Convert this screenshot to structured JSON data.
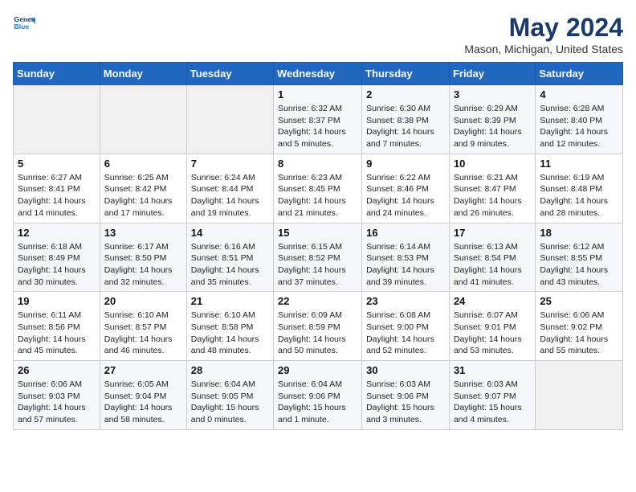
{
  "header": {
    "logo_line1": "General",
    "logo_line2": "Blue",
    "month": "May 2024",
    "location": "Mason, Michigan, United States"
  },
  "weekdays": [
    "Sunday",
    "Monday",
    "Tuesday",
    "Wednesday",
    "Thursday",
    "Friday",
    "Saturday"
  ],
  "weeks": [
    [
      {
        "day": "",
        "info": ""
      },
      {
        "day": "",
        "info": ""
      },
      {
        "day": "",
        "info": ""
      },
      {
        "day": "1",
        "info": "Sunrise: 6:32 AM\nSunset: 8:37 PM\nDaylight: 14 hours\nand 5 minutes."
      },
      {
        "day": "2",
        "info": "Sunrise: 6:30 AM\nSunset: 8:38 PM\nDaylight: 14 hours\nand 7 minutes."
      },
      {
        "day": "3",
        "info": "Sunrise: 6:29 AM\nSunset: 8:39 PM\nDaylight: 14 hours\nand 9 minutes."
      },
      {
        "day": "4",
        "info": "Sunrise: 6:28 AM\nSunset: 8:40 PM\nDaylight: 14 hours\nand 12 minutes."
      }
    ],
    [
      {
        "day": "5",
        "info": "Sunrise: 6:27 AM\nSunset: 8:41 PM\nDaylight: 14 hours\nand 14 minutes."
      },
      {
        "day": "6",
        "info": "Sunrise: 6:25 AM\nSunset: 8:42 PM\nDaylight: 14 hours\nand 17 minutes."
      },
      {
        "day": "7",
        "info": "Sunrise: 6:24 AM\nSunset: 8:44 PM\nDaylight: 14 hours\nand 19 minutes."
      },
      {
        "day": "8",
        "info": "Sunrise: 6:23 AM\nSunset: 8:45 PM\nDaylight: 14 hours\nand 21 minutes."
      },
      {
        "day": "9",
        "info": "Sunrise: 6:22 AM\nSunset: 8:46 PM\nDaylight: 14 hours\nand 24 minutes."
      },
      {
        "day": "10",
        "info": "Sunrise: 6:21 AM\nSunset: 8:47 PM\nDaylight: 14 hours\nand 26 minutes."
      },
      {
        "day": "11",
        "info": "Sunrise: 6:19 AM\nSunset: 8:48 PM\nDaylight: 14 hours\nand 28 minutes."
      }
    ],
    [
      {
        "day": "12",
        "info": "Sunrise: 6:18 AM\nSunset: 8:49 PM\nDaylight: 14 hours\nand 30 minutes."
      },
      {
        "day": "13",
        "info": "Sunrise: 6:17 AM\nSunset: 8:50 PM\nDaylight: 14 hours\nand 32 minutes."
      },
      {
        "day": "14",
        "info": "Sunrise: 6:16 AM\nSunset: 8:51 PM\nDaylight: 14 hours\nand 35 minutes."
      },
      {
        "day": "15",
        "info": "Sunrise: 6:15 AM\nSunset: 8:52 PM\nDaylight: 14 hours\nand 37 minutes."
      },
      {
        "day": "16",
        "info": "Sunrise: 6:14 AM\nSunset: 8:53 PM\nDaylight: 14 hours\nand 39 minutes."
      },
      {
        "day": "17",
        "info": "Sunrise: 6:13 AM\nSunset: 8:54 PM\nDaylight: 14 hours\nand 41 minutes."
      },
      {
        "day": "18",
        "info": "Sunrise: 6:12 AM\nSunset: 8:55 PM\nDaylight: 14 hours\nand 43 minutes."
      }
    ],
    [
      {
        "day": "19",
        "info": "Sunrise: 6:11 AM\nSunset: 8:56 PM\nDaylight: 14 hours\nand 45 minutes."
      },
      {
        "day": "20",
        "info": "Sunrise: 6:10 AM\nSunset: 8:57 PM\nDaylight: 14 hours\nand 46 minutes."
      },
      {
        "day": "21",
        "info": "Sunrise: 6:10 AM\nSunset: 8:58 PM\nDaylight: 14 hours\nand 48 minutes."
      },
      {
        "day": "22",
        "info": "Sunrise: 6:09 AM\nSunset: 8:59 PM\nDaylight: 14 hours\nand 50 minutes."
      },
      {
        "day": "23",
        "info": "Sunrise: 6:08 AM\nSunset: 9:00 PM\nDaylight: 14 hours\nand 52 minutes."
      },
      {
        "day": "24",
        "info": "Sunrise: 6:07 AM\nSunset: 9:01 PM\nDaylight: 14 hours\nand 53 minutes."
      },
      {
        "day": "25",
        "info": "Sunrise: 6:06 AM\nSunset: 9:02 PM\nDaylight: 14 hours\nand 55 minutes."
      }
    ],
    [
      {
        "day": "26",
        "info": "Sunrise: 6:06 AM\nSunset: 9:03 PM\nDaylight: 14 hours\nand 57 minutes."
      },
      {
        "day": "27",
        "info": "Sunrise: 6:05 AM\nSunset: 9:04 PM\nDaylight: 14 hours\nand 58 minutes."
      },
      {
        "day": "28",
        "info": "Sunrise: 6:04 AM\nSunset: 9:05 PM\nDaylight: 15 hours\nand 0 minutes."
      },
      {
        "day": "29",
        "info": "Sunrise: 6:04 AM\nSunset: 9:06 PM\nDaylight: 15 hours\nand 1 minute."
      },
      {
        "day": "30",
        "info": "Sunrise: 6:03 AM\nSunset: 9:06 PM\nDaylight: 15 hours\nand 3 minutes."
      },
      {
        "day": "31",
        "info": "Sunrise: 6:03 AM\nSunset: 9:07 PM\nDaylight: 15 hours\nand 4 minutes."
      },
      {
        "day": "",
        "info": ""
      }
    ]
  ]
}
